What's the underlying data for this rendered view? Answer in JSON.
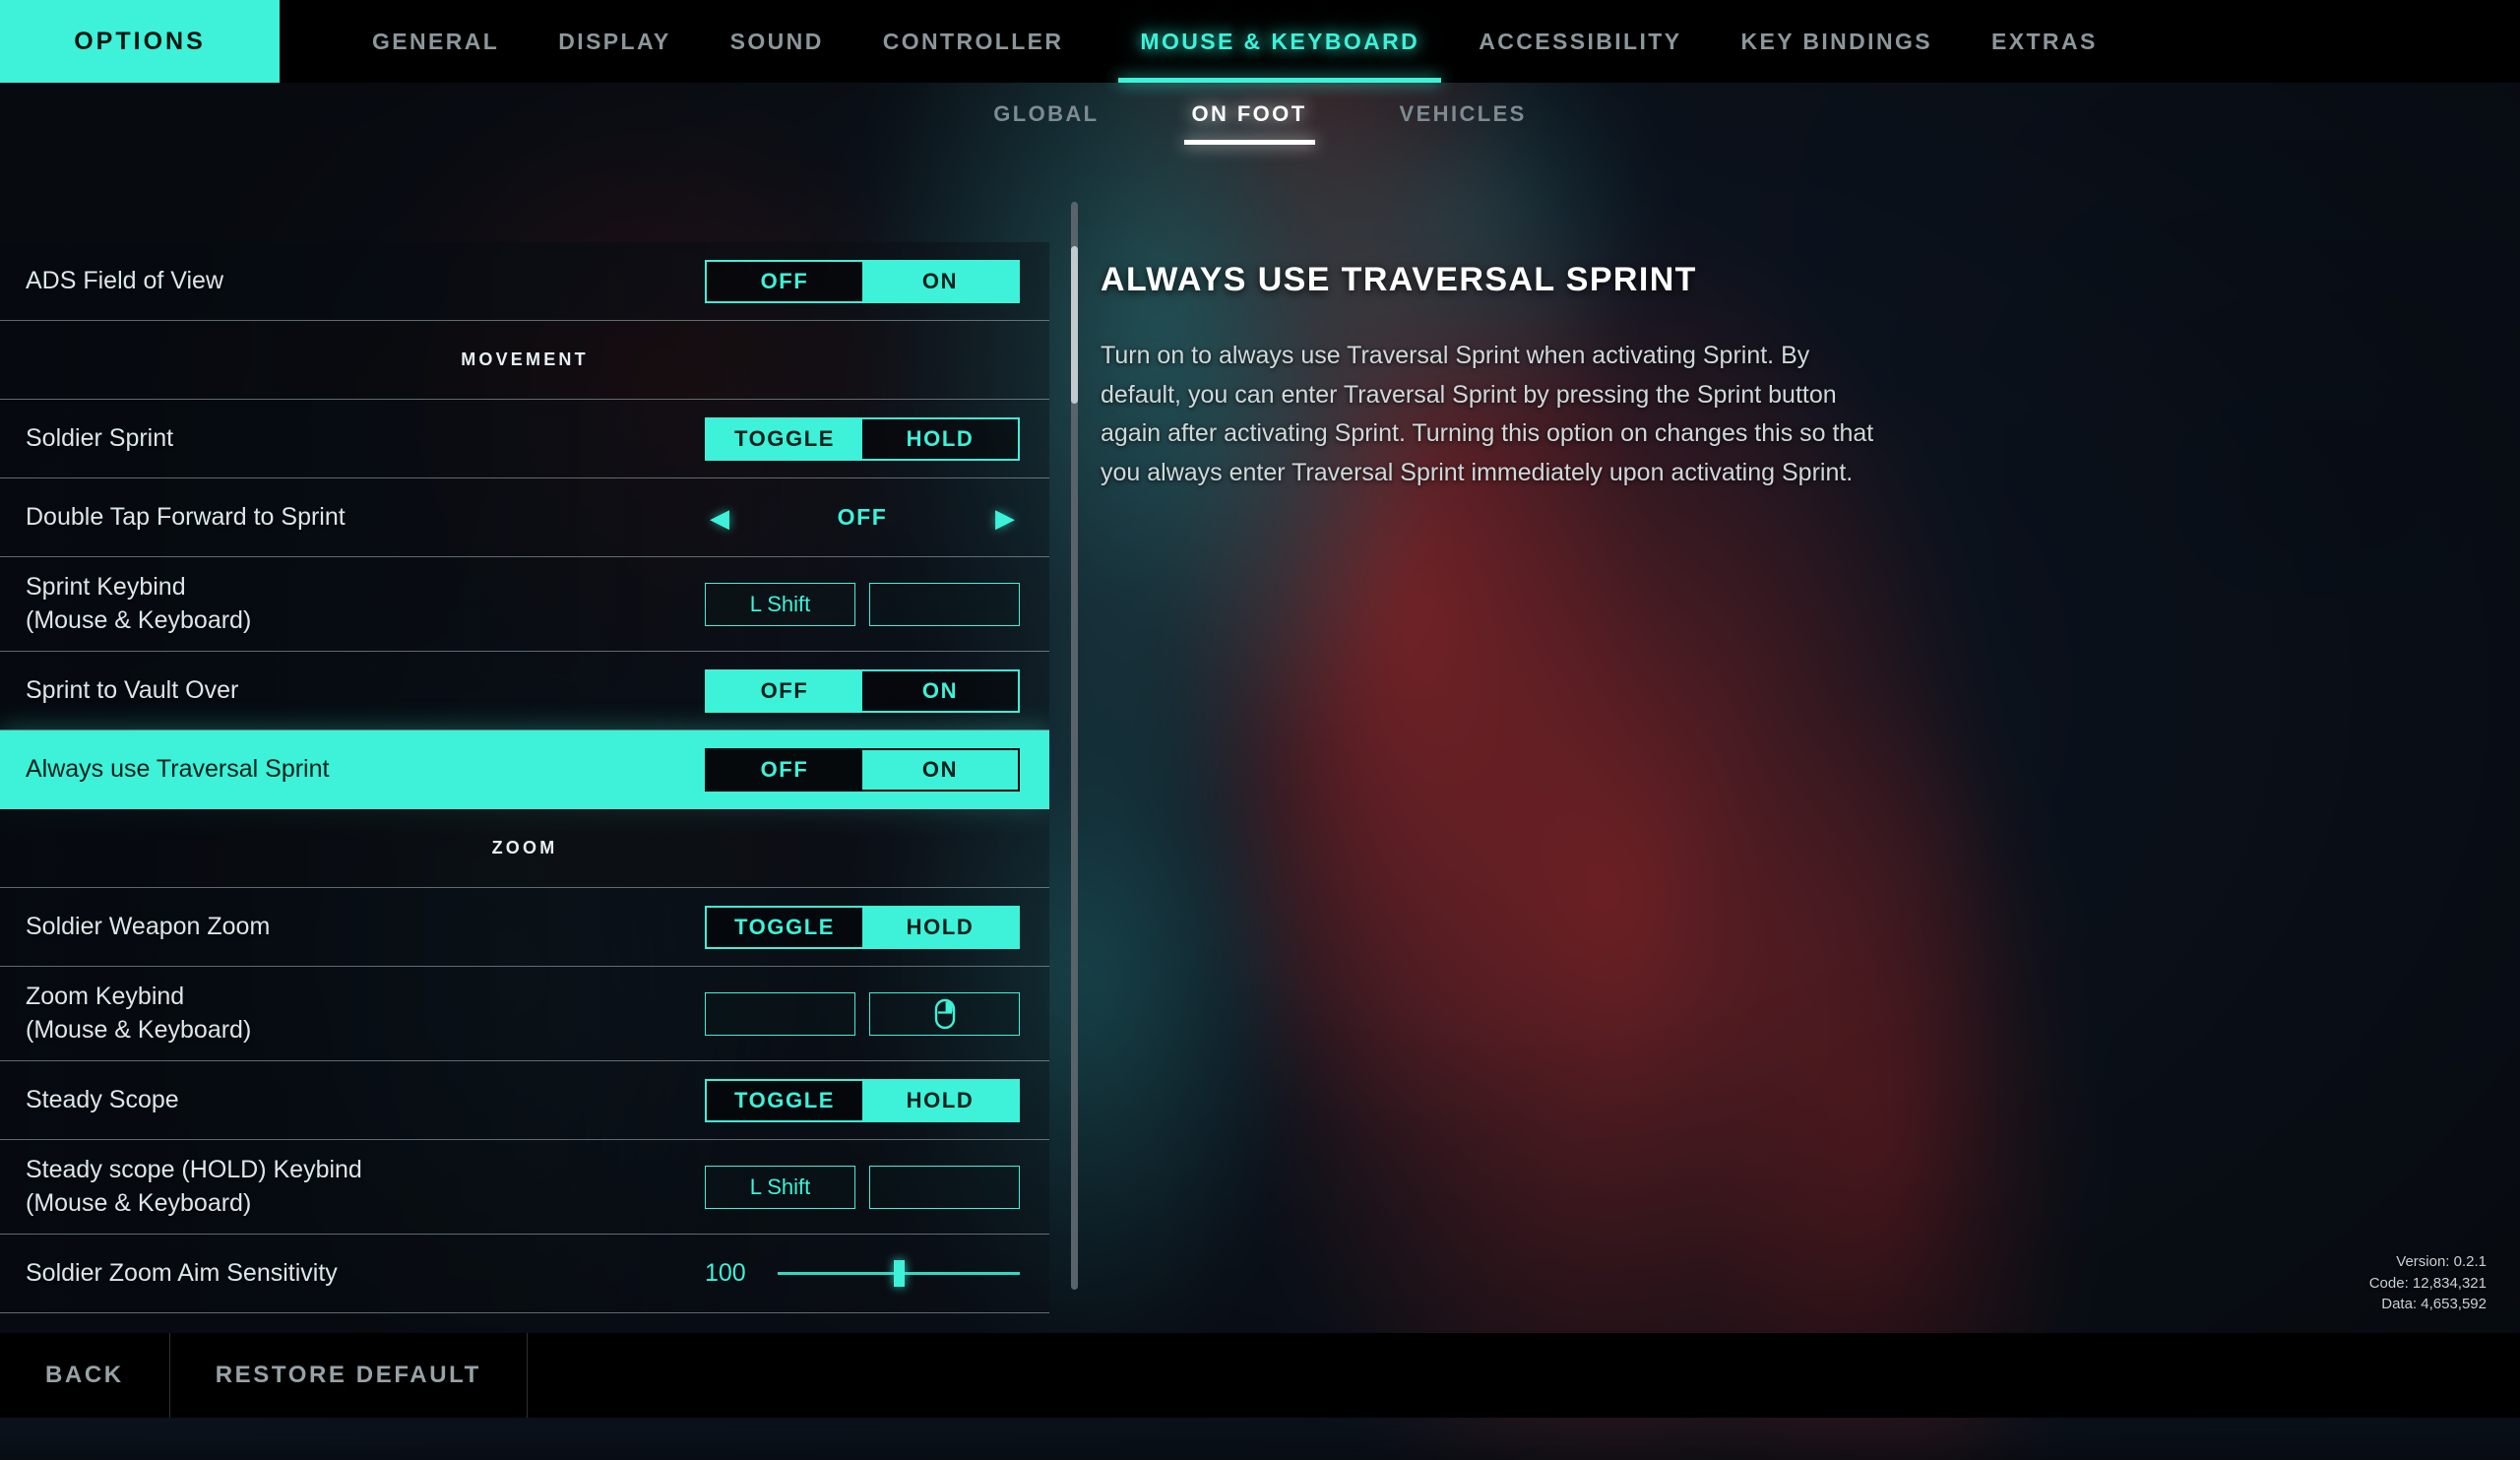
{
  "topnav": {
    "brand": "OPTIONS",
    "items": [
      {
        "label": "GENERAL",
        "active": false
      },
      {
        "label": "DISPLAY",
        "active": false
      },
      {
        "label": "SOUND",
        "active": false
      },
      {
        "label": "CONTROLLER",
        "active": false
      },
      {
        "label": "MOUSE & KEYBOARD",
        "active": true
      },
      {
        "label": "ACCESSIBILITY",
        "active": false
      },
      {
        "label": "KEY BINDINGS",
        "active": false
      },
      {
        "label": "EXTRAS",
        "active": false
      }
    ]
  },
  "subnav": {
    "items": [
      {
        "label": "GLOBAL",
        "active": false
      },
      {
        "label": "ON FOOT",
        "active": true
      },
      {
        "label": "VEHICLES",
        "active": false
      }
    ]
  },
  "settings": {
    "rows": [
      {
        "label": "ADS Field of View",
        "type": "toggle",
        "options": [
          "OFF",
          "ON"
        ],
        "selected": "ON"
      },
      {
        "label": "MOVEMENT",
        "type": "section"
      },
      {
        "label": "Soldier Sprint",
        "type": "toggle",
        "options": [
          "TOGGLE",
          "HOLD"
        ],
        "selected": "TOGGLE"
      },
      {
        "label": "Double Tap Forward to Sprint",
        "type": "arrows",
        "value": "OFF",
        "left_arrow": "◀",
        "right_arrow": "▶"
      },
      {
        "label": "Sprint Keybind",
        "sublabel": "(Mouse & Keyboard)",
        "type": "keybind",
        "primary": "L Shift",
        "secondary": ""
      },
      {
        "label": "Sprint to Vault Over",
        "type": "toggle",
        "options": [
          "OFF",
          "ON"
        ],
        "selected": "OFF"
      },
      {
        "label": "Always use Traversal Sprint",
        "type": "toggle",
        "options": [
          "OFF",
          "ON"
        ],
        "selected": "OFF",
        "highlighted": true
      },
      {
        "label": "ZOOM",
        "type": "section"
      },
      {
        "label": "Soldier Weapon Zoom",
        "type": "toggle",
        "options": [
          "TOGGLE",
          "HOLD"
        ],
        "selected": "HOLD"
      },
      {
        "label": "Zoom Keybind",
        "sublabel": "(Mouse & Keyboard)",
        "type": "keybind",
        "primary": "",
        "secondary": "mouse-right-button-icon"
      },
      {
        "label": "Steady Scope",
        "type": "toggle",
        "options": [
          "TOGGLE",
          "HOLD"
        ],
        "selected": "HOLD"
      },
      {
        "label": "Steady scope (HOLD) Keybind",
        "sublabel": "(Mouse & Keyboard)",
        "type": "keybind",
        "primary": "L Shift",
        "secondary": ""
      },
      {
        "label": "Soldier Zoom Aim Sensitivity",
        "type": "slider",
        "value": "100",
        "percent": 50
      }
    ]
  },
  "detail": {
    "title": "ALWAYS USE TRAVERSAL SPRINT",
    "body": "Turn on to always use Traversal Sprint when activating Sprint. By default, you can enter Traversal Sprint by pressing the Sprint button again after activating Sprint. Turning this option on changes this so that you always enter Traversal Sprint immediately upon activating Sprint."
  },
  "version_info": {
    "version": "Version: 0.2.1",
    "code": "Code: 12,834,321",
    "data": "Data: 4,653,592"
  },
  "bottombar": {
    "back": "BACK",
    "restore_default": "RESTORE DEFAULT"
  },
  "colors": {
    "accent": "#3df2d8",
    "accent_text_dark": "#04201c",
    "label_text": "#dbe7ea",
    "inactive_nav": "#8c979c",
    "divider": "#aab9be"
  }
}
